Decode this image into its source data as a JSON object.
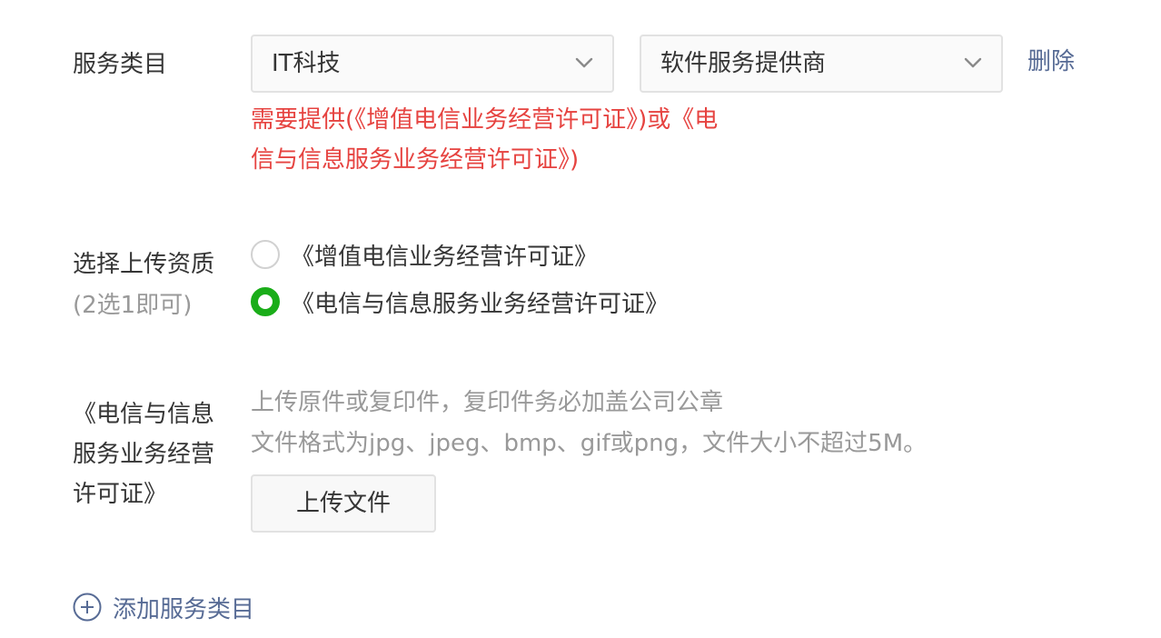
{
  "service_category": {
    "label": "服务类目",
    "primary_select": {
      "value": "IT科技",
      "icon": "chevron-down-icon"
    },
    "secondary_select": {
      "value": "软件服务提供商",
      "icon": "chevron-down-icon"
    },
    "delete_label": "删除",
    "requirement_notice": {
      "line1": "需要提供(《增值电信业务经营许可证》)或《电",
      "line2": "信与信息服务业务经营许可证》)",
      "color": "#e64340"
    }
  },
  "qualification": {
    "label": "选择上传资质",
    "sub_label": "(2选1即可)",
    "options": [
      {
        "label": "《增值电信业务经营许可证》",
        "checked": false
      },
      {
        "label": "《电信与信息服务业务经营许可证》",
        "checked": true
      }
    ],
    "checked_color": "#1aad19"
  },
  "upload": {
    "label_lines": [
      "《电信与信息",
      "服务业务经营",
      "许可证》"
    ],
    "hint_line1": "上传原件或复印件，复印件务必加盖公司公章",
    "hint_line2": "文件格式为jpg、jpeg、bmp、gif或png，文件大小不超过5M。",
    "button_label": "上传文件"
  },
  "add_category": {
    "label": "添加服务类目",
    "icon": "plus-circle-icon",
    "color": "#576b95"
  }
}
